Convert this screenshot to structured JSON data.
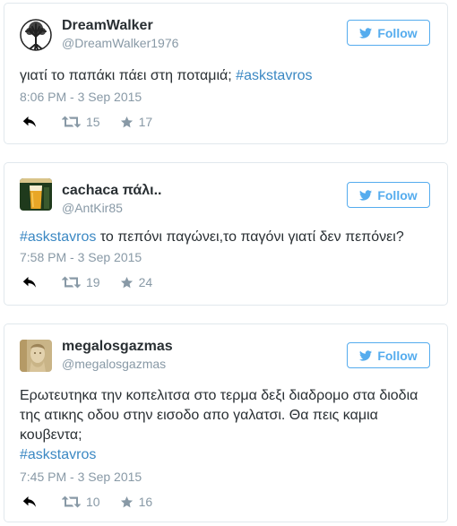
{
  "tweets": [
    {
      "name": "DreamWalker",
      "handle": "@DreamWalker1976",
      "follow_label": "Follow",
      "text_before": "γιατί το παπάκι πάει στη ποταμιά; ",
      "hashtag": "#askstavros",
      "text_after": "",
      "timestamp": "8:06 PM - 3 Sep 2015",
      "retweets": "15",
      "favorites": "17",
      "avatar_icon": "tree-of-life-avatar"
    },
    {
      "name": "cachaca πάλι..",
      "handle": "@AntKir85",
      "follow_label": "Follow",
      "hashtag": "#askstavros",
      "text_after": " το πεπόνι παγώνει,το παγόνι γιατί δεν πεπόνει?",
      "timestamp": "7:58 PM - 3 Sep 2015",
      "retweets": "19",
      "favorites": "24",
      "avatar_icon": "beer-glass-avatar"
    },
    {
      "name": "megalosgazmas",
      "handle": "@megalosgazmas",
      "follow_label": "Follow",
      "text_before": "Ερωτευτηκα την κοπελιτσα στο τερμα δεξι διαδρομο στα διοδια της ατικης οδου στην εισοδο απο γαλατσι. Θα πεις καμια κουβεντα;",
      "hashtag": "#askstavros",
      "timestamp": "7:45 PM - 3 Sep 2015",
      "retweets": "10",
      "favorites": "16",
      "avatar_icon": "statue-avatar"
    }
  ],
  "colors": {
    "accent": "#55acee",
    "hashtag": "#3b88c3",
    "muted": "#8899a6",
    "text": "#292f33",
    "border": "#e1e8ed"
  }
}
